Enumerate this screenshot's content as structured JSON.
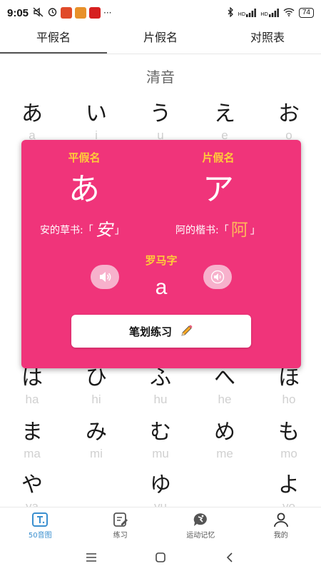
{
  "status_bar": {
    "time": "9:05",
    "more": "···",
    "battery": "74",
    "signal_1": "HD",
    "signal_2": "HD"
  },
  "tabs": [
    {
      "label": "平假名",
      "active": true
    },
    {
      "label": "片假名",
      "active": false
    },
    {
      "label": "对照表",
      "active": false
    }
  ],
  "section_title": "清音",
  "kana_rows": [
    [
      {
        "k": "あ",
        "r": "a"
      },
      {
        "k": "い",
        "r": "i"
      },
      {
        "k": "う",
        "r": "u"
      },
      {
        "k": "え",
        "r": "e"
      },
      {
        "k": "お",
        "r": "o"
      }
    ],
    [
      {
        "k": "は",
        "r": "ha"
      },
      {
        "k": "ひ",
        "r": "hi"
      },
      {
        "k": "ふ",
        "r": "hu"
      },
      {
        "k": "へ",
        "r": "he"
      },
      {
        "k": "ほ",
        "r": "ho"
      }
    ],
    [
      {
        "k": "ま",
        "r": "ma"
      },
      {
        "k": "み",
        "r": "mi"
      },
      {
        "k": "む",
        "r": "mu"
      },
      {
        "k": "め",
        "r": "me"
      },
      {
        "k": "も",
        "r": "mo"
      }
    ],
    [
      {
        "k": "や",
        "r": "ya"
      },
      {
        "k": "",
        "r": ""
      },
      {
        "k": "ゆ",
        "r": "yu"
      },
      {
        "k": "",
        "r": ""
      },
      {
        "k": "よ",
        "r": "yo"
      }
    ]
  ],
  "card": {
    "hiragana_label": "平假名",
    "katakana_label": "片假名",
    "hiragana": "あ",
    "katakana": "ア",
    "cursive_prefix": "安的草书:「",
    "cursive_glyph": "安",
    "cursive_suffix": "」",
    "regular_prefix": "阿的楷书:「",
    "regular_glyph": "阿",
    "regular_suffix": "」",
    "romaji_label": "罗马字",
    "romaji": "a",
    "stroke_button": "笔划练习"
  },
  "bottom_nav": [
    {
      "label": "50音图",
      "icon": "kana-chart-icon",
      "active": true
    },
    {
      "label": "练习",
      "icon": "practice-icon",
      "active": false
    },
    {
      "label": "运动记忆",
      "icon": "motion-memory-icon",
      "active": false
    },
    {
      "label": "我的",
      "icon": "profile-icon",
      "active": false
    }
  ],
  "colors": {
    "card_bg": "#f0347a",
    "card_label": "#ffcc3a",
    "accent_blue": "#3a8fcf"
  }
}
